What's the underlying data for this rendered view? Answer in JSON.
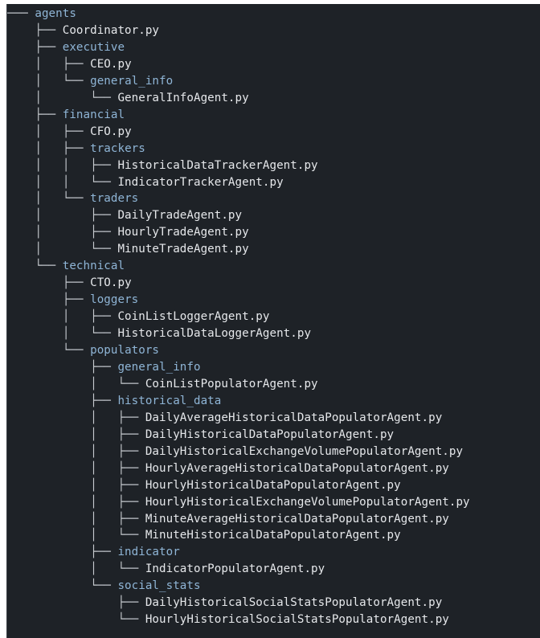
{
  "tree": {
    "lines": [
      {
        "prefix": "─── ",
        "name": "agents",
        "kind": "dir"
      },
      {
        "prefix": "    ├── ",
        "name": "Coordinator.py",
        "kind": "file"
      },
      {
        "prefix": "    ├── ",
        "name": "executive",
        "kind": "dir"
      },
      {
        "prefix": "    │   ├── ",
        "name": "CEO.py",
        "kind": "file"
      },
      {
        "prefix": "    │   └── ",
        "name": "general_info",
        "kind": "dir"
      },
      {
        "prefix": "    │       └── ",
        "name": "GeneralInfoAgent.py",
        "kind": "file"
      },
      {
        "prefix": "    ├── ",
        "name": "financial",
        "kind": "dir"
      },
      {
        "prefix": "    │   ├── ",
        "name": "CFO.py",
        "kind": "file"
      },
      {
        "prefix": "    │   ├── ",
        "name": "trackers",
        "kind": "dir"
      },
      {
        "prefix": "    │   │   ├── ",
        "name": "HistoricalDataTrackerAgent.py",
        "kind": "file"
      },
      {
        "prefix": "    │   │   └── ",
        "name": "IndicatorTrackerAgent.py",
        "kind": "file"
      },
      {
        "prefix": "    │   └── ",
        "name": "traders",
        "kind": "dir"
      },
      {
        "prefix": "    │       ├── ",
        "name": "DailyTradeAgent.py",
        "kind": "file"
      },
      {
        "prefix": "    │       ├── ",
        "name": "HourlyTradeAgent.py",
        "kind": "file"
      },
      {
        "prefix": "    │       └── ",
        "name": "MinuteTradeAgent.py",
        "kind": "file"
      },
      {
        "prefix": "    └── ",
        "name": "technical",
        "kind": "dir"
      },
      {
        "prefix": "        ├── ",
        "name": "CTO.py",
        "kind": "file"
      },
      {
        "prefix": "        ├── ",
        "name": "loggers",
        "kind": "dir"
      },
      {
        "prefix": "        │   ├── ",
        "name": "CoinListLoggerAgent.py",
        "kind": "file"
      },
      {
        "prefix": "        │   └── ",
        "name": "HistoricalDataLoggerAgent.py",
        "kind": "file"
      },
      {
        "prefix": "        └── ",
        "name": "populators",
        "kind": "dir"
      },
      {
        "prefix": "            ├── ",
        "name": "general_info",
        "kind": "dir"
      },
      {
        "prefix": "            │   └── ",
        "name": "CoinListPopulatorAgent.py",
        "kind": "file"
      },
      {
        "prefix": "            ├── ",
        "name": "historical_data",
        "kind": "dir"
      },
      {
        "prefix": "            │   ├── ",
        "name": "DailyAverageHistoricalDataPopulatorAgent.py",
        "kind": "file"
      },
      {
        "prefix": "            │   ├── ",
        "name": "DailyHistoricalDataPopulatorAgent.py",
        "kind": "file"
      },
      {
        "prefix": "            │   ├── ",
        "name": "DailyHistoricalExchangeVolumePopulatorAgent.py",
        "kind": "file"
      },
      {
        "prefix": "            │   ├── ",
        "name": "HourlyAverageHistoricalDataPopulatorAgent.py",
        "kind": "file"
      },
      {
        "prefix": "            │   ├── ",
        "name": "HourlyHistoricalDataPopulatorAgent.py",
        "kind": "file"
      },
      {
        "prefix": "            │   ├── ",
        "name": "HourlyHistoricalExchangeVolumePopulatorAgent.py",
        "kind": "file"
      },
      {
        "prefix": "            │   ├── ",
        "name": "MinuteAverageHistoricalDataPopulatorAgent.py",
        "kind": "file"
      },
      {
        "prefix": "            │   └── ",
        "name": "MinuteHistoricalDataPopulatorAgent.py",
        "kind": "file"
      },
      {
        "prefix": "            ├── ",
        "name": "indicator",
        "kind": "dir"
      },
      {
        "prefix": "            │   └── ",
        "name": "IndicatorPopulatorAgent.py",
        "kind": "file"
      },
      {
        "prefix": "            └── ",
        "name": "social_stats",
        "kind": "dir"
      },
      {
        "prefix": "                ├── ",
        "name": "DailyHistoricalSocialStatsPopulatorAgent.py",
        "kind": "file"
      },
      {
        "prefix": "                └── ",
        "name": "HourlyHistoricalSocialStatsPopulatorAgent.py",
        "kind": "file"
      }
    ]
  }
}
